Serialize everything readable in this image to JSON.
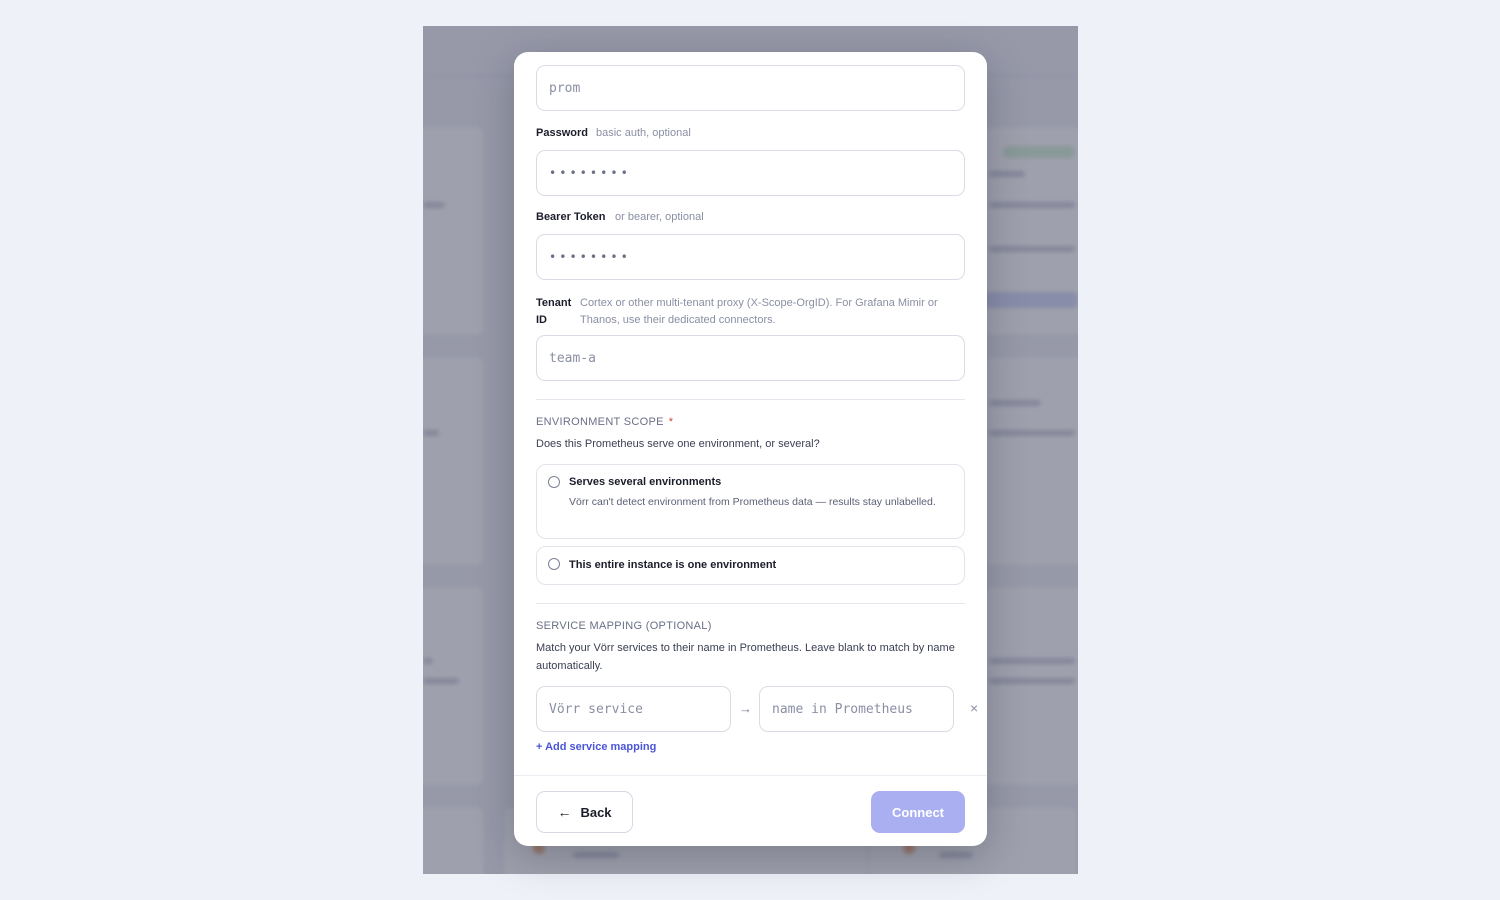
{
  "form": {
    "username_value": "prom",
    "password": {
      "label": "Password",
      "hint": "basic auth, optional",
      "value": "••••••••"
    },
    "bearer": {
      "label": "Bearer Token",
      "hint": "or bearer, optional",
      "value": "••••••••"
    },
    "tenant": {
      "label_line1": "Tenant",
      "label_line2": "ID",
      "hint": "Cortex or other multi-tenant proxy (X-Scope-OrgID). For Grafana Mimir or Thanos, use their dedicated connectors.",
      "value": "team-a"
    }
  },
  "environment_scope": {
    "title": "ENVIRONMENT SCOPE",
    "required_mark": "*",
    "description": "Does this Prometheus serve one environment, or several?",
    "options": [
      {
        "title": "Serves several environments",
        "subtitle": "Vörr can't detect environment from Prometheus data — results stay unlabelled.",
        "selected": false
      },
      {
        "title": "This entire instance is one environment",
        "selected": false
      }
    ]
  },
  "service_mapping": {
    "title": "SERVICE MAPPING (OPTIONAL)",
    "description": "Match your Vörr services to their name in Prometheus. Leave blank to match by name automatically.",
    "service_placeholder": "Vörr service",
    "prometheus_placeholder": "name in Prometheus",
    "arrow_icon": "→",
    "remove_icon": "×",
    "add_label": "+ Add service mapping"
  },
  "footer": {
    "back_icon": "←",
    "back_label": "Back",
    "connect_label": "Connect"
  },
  "colors": {
    "accent": "#4a55d8",
    "connect_disabled": "#a9aff0",
    "required": "#d0443a"
  }
}
